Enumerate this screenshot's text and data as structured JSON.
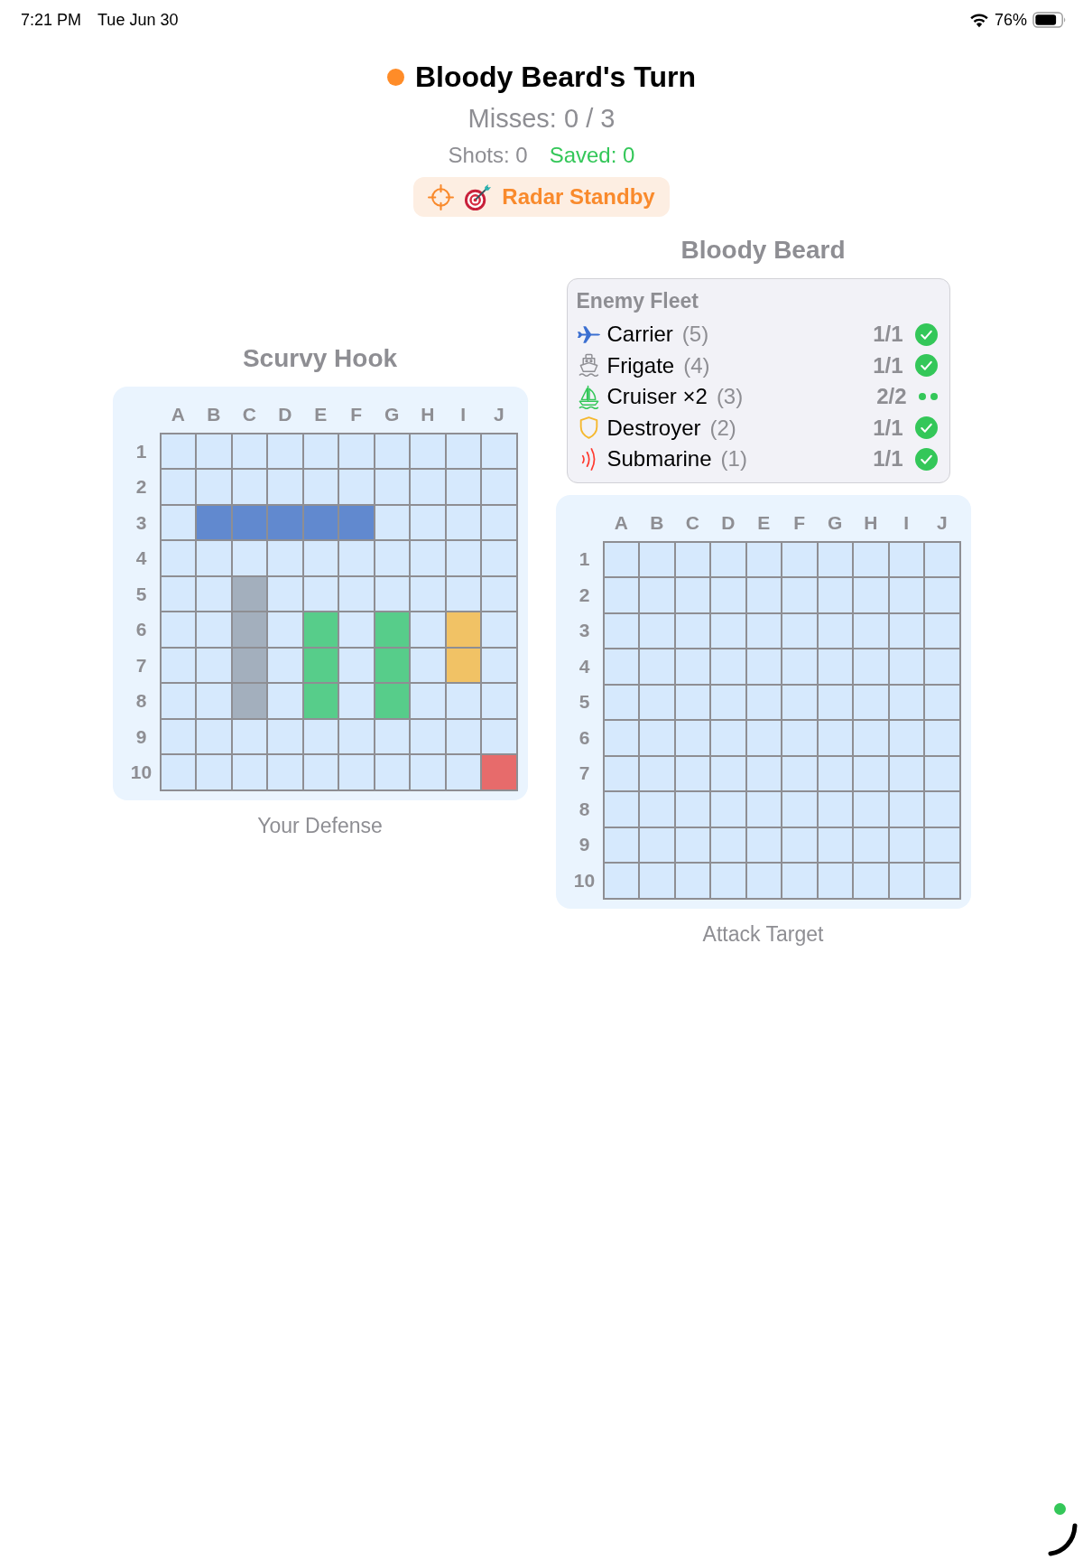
{
  "status_bar": {
    "time": "7:21 PM",
    "date": "Tue Jun 30",
    "battery": "76%"
  },
  "turn": {
    "title": "Bloody Beard's Turn",
    "color": "#ff8c28",
    "misses": "Misses: 0 / 3",
    "stats": [
      {
        "text": "Shots: 0",
        "color": "#8e8e93"
      },
      {
        "text": "Saved: 0",
        "color": "#34c759"
      }
    ],
    "radar": {
      "label": "Radar Standby"
    }
  },
  "players": [
    {
      "name": "Scurvy Hook",
      "board": {
        "columns": [
          "A",
          "B",
          "C",
          "D",
          "E",
          "F",
          "G",
          "H",
          "I",
          "J"
        ],
        "rows": [
          {
            "label": "1",
            "cells": [
              {
                "color": "#d6e9fd"
              },
              {
                "color": "#d6e9fd"
              },
              {
                "color": "#d6e9fd"
              },
              {
                "color": "#d6e9fd"
              },
              {
                "color": "#d6e9fd"
              },
              {
                "color": "#d6e9fd"
              },
              {
                "color": "#d6e9fd"
              },
              {
                "color": "#d6e9fd"
              },
              {
                "color": "#d6e9fd"
              },
              {
                "color": "#d6e9fd"
              }
            ]
          },
          {
            "label": "2",
            "cells": [
              {
                "color": "#d6e9fd"
              },
              {
                "color": "#d6e9fd"
              },
              {
                "color": "#d6e9fd"
              },
              {
                "color": "#d6e9fd"
              },
              {
                "color": "#d6e9fd"
              },
              {
                "color": "#d6e9fd"
              },
              {
                "color": "#d6e9fd"
              },
              {
                "color": "#d6e9fd"
              },
              {
                "color": "#d6e9fd"
              },
              {
                "color": "#d6e9fd"
              }
            ]
          },
          {
            "label": "3",
            "cells": [
              {
                "color": "#d6e9fd"
              },
              {
                "color": "#6189cf"
              },
              {
                "color": "#6189cf"
              },
              {
                "color": "#6189cf"
              },
              {
                "color": "#6189cf"
              },
              {
                "color": "#6189cf"
              },
              {
                "color": "#d6e9fd"
              },
              {
                "color": "#d6e9fd"
              },
              {
                "color": "#d6e9fd"
              },
              {
                "color": "#d6e9fd"
              }
            ]
          },
          {
            "label": "4",
            "cells": [
              {
                "color": "#d6e9fd"
              },
              {
                "color": "#d6e9fd"
              },
              {
                "color": "#d6e9fd"
              },
              {
                "color": "#d6e9fd"
              },
              {
                "color": "#d6e9fd"
              },
              {
                "color": "#d6e9fd"
              },
              {
                "color": "#d6e9fd"
              },
              {
                "color": "#d6e9fd"
              },
              {
                "color": "#d6e9fd"
              },
              {
                "color": "#d6e9fd"
              }
            ]
          },
          {
            "label": "5",
            "cells": [
              {
                "color": "#d6e9fd"
              },
              {
                "color": "#d6e9fd"
              },
              {
                "color": "#a3afbd"
              },
              {
                "color": "#d6e9fd"
              },
              {
                "color": "#d6e9fd"
              },
              {
                "color": "#d6e9fd"
              },
              {
                "color": "#d6e9fd"
              },
              {
                "color": "#d6e9fd"
              },
              {
                "color": "#d6e9fd"
              },
              {
                "color": "#d6e9fd"
              }
            ]
          },
          {
            "label": "6",
            "cells": [
              {
                "color": "#d6e9fd"
              },
              {
                "color": "#d6e9fd"
              },
              {
                "color": "#a3afbd"
              },
              {
                "color": "#d6e9fd"
              },
              {
                "color": "#57cd8a"
              },
              {
                "color": "#d6e9fd"
              },
              {
                "color": "#57cd8a"
              },
              {
                "color": "#d6e9fd"
              },
              {
                "color": "#f1c265"
              },
              {
                "color": "#d6e9fd"
              }
            ]
          },
          {
            "label": "7",
            "cells": [
              {
                "color": "#d6e9fd"
              },
              {
                "color": "#d6e9fd"
              },
              {
                "color": "#a3afbd"
              },
              {
                "color": "#d6e9fd"
              },
              {
                "color": "#57cd8a"
              },
              {
                "color": "#d6e9fd"
              },
              {
                "color": "#57cd8a"
              },
              {
                "color": "#d6e9fd"
              },
              {
                "color": "#f1c265"
              },
              {
                "color": "#d6e9fd"
              }
            ]
          },
          {
            "label": "8",
            "cells": [
              {
                "color": "#d6e9fd"
              },
              {
                "color": "#d6e9fd"
              },
              {
                "color": "#a3afbd"
              },
              {
                "color": "#d6e9fd"
              },
              {
                "color": "#57cd8a"
              },
              {
                "color": "#d6e9fd"
              },
              {
                "color": "#57cd8a"
              },
              {
                "color": "#d6e9fd"
              },
              {
                "color": "#d6e9fd"
              },
              {
                "color": "#d6e9fd"
              }
            ]
          },
          {
            "label": "9",
            "cells": [
              {
                "color": "#d6e9fd"
              },
              {
                "color": "#d6e9fd"
              },
              {
                "color": "#d6e9fd"
              },
              {
                "color": "#d6e9fd"
              },
              {
                "color": "#d6e9fd"
              },
              {
                "color": "#d6e9fd"
              },
              {
                "color": "#d6e9fd"
              },
              {
                "color": "#d6e9fd"
              },
              {
                "color": "#d6e9fd"
              },
              {
                "color": "#d6e9fd"
              }
            ]
          },
          {
            "label": "10",
            "cells": [
              {
                "color": "#d6e9fd"
              },
              {
                "color": "#d6e9fd"
              },
              {
                "color": "#d6e9fd"
              },
              {
                "color": "#d6e9fd"
              },
              {
                "color": "#d6e9fd"
              },
              {
                "color": "#d6e9fd"
              },
              {
                "color": "#d6e9fd"
              },
              {
                "color": "#d6e9fd"
              },
              {
                "color": "#d6e9fd"
              },
              {
                "color": "#e76b6b"
              }
            ]
          }
        ]
      },
      "caption": "Your Defense"
    },
    {
      "name": "Bloody Beard",
      "fleet": {
        "title": "Enemy Fleet",
        "ships": [
          {
            "kind": "carrier",
            "color": "#3b6fd1",
            "name": "Carrier",
            "size": "(5)",
            "count": "1/1",
            "markers": [
              {
                "kind": "check"
              }
            ]
          },
          {
            "kind": "frigate",
            "color": "#8e8e93",
            "name": "Frigate",
            "size": "(4)",
            "count": "1/1",
            "markers": [
              {
                "kind": "check"
              }
            ]
          },
          {
            "kind": "cruiser",
            "color": "#34c759",
            "name": "Cruiser ×2",
            "size": "(3)",
            "count": "2/2",
            "markers": [
              {
                "kind": "dot"
              },
              {
                "kind": "dot"
              }
            ]
          },
          {
            "kind": "destroyer",
            "color": "#f5b82e",
            "name": "Destroyer",
            "size": "(2)",
            "count": "1/1",
            "markers": [
              {
                "kind": "check"
              }
            ]
          },
          {
            "kind": "submarine",
            "color": "#ff3b30",
            "name": "Submarine",
            "size": "(1)",
            "count": "1/1",
            "markers": [
              {
                "kind": "check"
              }
            ]
          }
        ]
      },
      "board": {
        "columns": [
          "A",
          "B",
          "C",
          "D",
          "E",
          "F",
          "G",
          "H",
          "I",
          "J"
        ],
        "rows": [
          {
            "label": "1",
            "cells": [
              {
                "color": "#d6e9fd"
              },
              {
                "color": "#d6e9fd"
              },
              {
                "color": "#d6e9fd"
              },
              {
                "color": "#d6e9fd"
              },
              {
                "color": "#d6e9fd"
              },
              {
                "color": "#d6e9fd"
              },
              {
                "color": "#d6e9fd"
              },
              {
                "color": "#d6e9fd"
              },
              {
                "color": "#d6e9fd"
              },
              {
                "color": "#d6e9fd"
              }
            ]
          },
          {
            "label": "2",
            "cells": [
              {
                "color": "#d6e9fd"
              },
              {
                "color": "#d6e9fd"
              },
              {
                "color": "#d6e9fd"
              },
              {
                "color": "#d6e9fd"
              },
              {
                "color": "#d6e9fd"
              },
              {
                "color": "#d6e9fd"
              },
              {
                "color": "#d6e9fd"
              },
              {
                "color": "#d6e9fd"
              },
              {
                "color": "#d6e9fd"
              },
              {
                "color": "#d6e9fd"
              }
            ]
          },
          {
            "label": "3",
            "cells": [
              {
                "color": "#d6e9fd"
              },
              {
                "color": "#d6e9fd"
              },
              {
                "color": "#d6e9fd"
              },
              {
                "color": "#d6e9fd"
              },
              {
                "color": "#d6e9fd"
              },
              {
                "color": "#d6e9fd"
              },
              {
                "color": "#d6e9fd"
              },
              {
                "color": "#d6e9fd"
              },
              {
                "color": "#d6e9fd"
              },
              {
                "color": "#d6e9fd"
              }
            ]
          },
          {
            "label": "4",
            "cells": [
              {
                "color": "#d6e9fd"
              },
              {
                "color": "#d6e9fd"
              },
              {
                "color": "#d6e9fd"
              },
              {
                "color": "#d6e9fd"
              },
              {
                "color": "#d6e9fd"
              },
              {
                "color": "#d6e9fd"
              },
              {
                "color": "#d6e9fd"
              },
              {
                "color": "#d6e9fd"
              },
              {
                "color": "#d6e9fd"
              },
              {
                "color": "#d6e9fd"
              }
            ]
          },
          {
            "label": "5",
            "cells": [
              {
                "color": "#d6e9fd"
              },
              {
                "color": "#d6e9fd"
              },
              {
                "color": "#d6e9fd"
              },
              {
                "color": "#d6e9fd"
              },
              {
                "color": "#d6e9fd"
              },
              {
                "color": "#d6e9fd"
              },
              {
                "color": "#d6e9fd"
              },
              {
                "color": "#d6e9fd"
              },
              {
                "color": "#d6e9fd"
              },
              {
                "color": "#d6e9fd"
              }
            ]
          },
          {
            "label": "6",
            "cells": [
              {
                "color": "#d6e9fd"
              },
              {
                "color": "#d6e9fd"
              },
              {
                "color": "#d6e9fd"
              },
              {
                "color": "#d6e9fd"
              },
              {
                "color": "#d6e9fd"
              },
              {
                "color": "#d6e9fd"
              },
              {
                "color": "#d6e9fd"
              },
              {
                "color": "#d6e9fd"
              },
              {
                "color": "#d6e9fd"
              },
              {
                "color": "#d6e9fd"
              }
            ]
          },
          {
            "label": "7",
            "cells": [
              {
                "color": "#d6e9fd"
              },
              {
                "color": "#d6e9fd"
              },
              {
                "color": "#d6e9fd"
              },
              {
                "color": "#d6e9fd"
              },
              {
                "color": "#d6e9fd"
              },
              {
                "color": "#d6e9fd"
              },
              {
                "color": "#d6e9fd"
              },
              {
                "color": "#d6e9fd"
              },
              {
                "color": "#d6e9fd"
              },
              {
                "color": "#d6e9fd"
              }
            ]
          },
          {
            "label": "8",
            "cells": [
              {
                "color": "#d6e9fd"
              },
              {
                "color": "#d6e9fd"
              },
              {
                "color": "#d6e9fd"
              },
              {
                "color": "#d6e9fd"
              },
              {
                "color": "#d6e9fd"
              },
              {
                "color": "#d6e9fd"
              },
              {
                "color": "#d6e9fd"
              },
              {
                "color": "#d6e9fd"
              },
              {
                "color": "#d6e9fd"
              },
              {
                "color": "#d6e9fd"
              }
            ]
          },
          {
            "label": "9",
            "cells": [
              {
                "color": "#d6e9fd"
              },
              {
                "color": "#d6e9fd"
              },
              {
                "color": "#d6e9fd"
              },
              {
                "color": "#d6e9fd"
              },
              {
                "color": "#d6e9fd"
              },
              {
                "color": "#d6e9fd"
              },
              {
                "color": "#d6e9fd"
              },
              {
                "color": "#d6e9fd"
              },
              {
                "color": "#d6e9fd"
              },
              {
                "color": "#d6e9fd"
              }
            ]
          },
          {
            "label": "10",
            "cells": [
              {
                "color": "#d6e9fd"
              },
              {
                "color": "#d6e9fd"
              },
              {
                "color": "#d6e9fd"
              },
              {
                "color": "#d6e9fd"
              },
              {
                "color": "#d6e9fd"
              },
              {
                "color": "#d6e9fd"
              },
              {
                "color": "#d6e9fd"
              },
              {
                "color": "#d6e9fd"
              },
              {
                "color": "#d6e9fd"
              },
              {
                "color": "#d6e9fd"
              }
            ]
          }
        ]
      },
      "caption": "Attack Target"
    }
  ]
}
